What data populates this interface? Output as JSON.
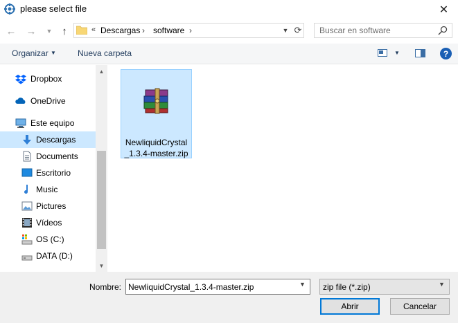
{
  "window": {
    "title": "please select file",
    "close_glyph": "✕"
  },
  "nav": {
    "back_glyph": "←",
    "forward_glyph": "→",
    "recent_glyph": "⌄",
    "up_glyph": "↑",
    "breadcrumb_prefix": "«",
    "breadcrumbs": [
      "Descargas",
      "software"
    ],
    "separator": "›",
    "refresh_glyph": "⟳",
    "search_placeholder": "Buscar en software"
  },
  "toolbar": {
    "organize_label": "Organizar",
    "new_folder_label": "Nueva carpeta",
    "help_label": "?"
  },
  "sidebar": {
    "items": [
      {
        "label": "Dropbox",
        "icon": "dropbox-icon"
      },
      {
        "label": "OneDrive",
        "icon": "onedrive-icon"
      },
      {
        "label": "Este equipo",
        "icon": "computer-icon"
      },
      {
        "label": "Descargas",
        "icon": "downloads-icon",
        "selected": true
      },
      {
        "label": "Documents",
        "icon": "documents-icon"
      },
      {
        "label": "Escritorio",
        "icon": "desktop-icon"
      },
      {
        "label": "Music",
        "icon": "music-icon"
      },
      {
        "label": "Pictures",
        "icon": "pictures-icon"
      },
      {
        "label": "Vídeos",
        "icon": "videos-icon"
      },
      {
        "label": "OS (C:)",
        "icon": "drive-c-icon"
      },
      {
        "label": "DATA (D:)",
        "icon": "drive-d-icon"
      }
    ]
  },
  "files": [
    {
      "name_line1": "NewliquidCrystal",
      "name_line2": "_1.3.4-master.zip",
      "icon": "winrar-archive-icon",
      "selected": true
    }
  ],
  "footer": {
    "name_label": "Nombre:",
    "name_value": "NewliquidCrystal_1.3.4-master.zip",
    "filter_value": "zip file (*.zip)",
    "open_label": "Abrir",
    "cancel_label": "Cancelar"
  },
  "colors": {
    "selection": "#cce8ff",
    "accent": "#0078d7",
    "toolbar_text": "#1e395b"
  }
}
